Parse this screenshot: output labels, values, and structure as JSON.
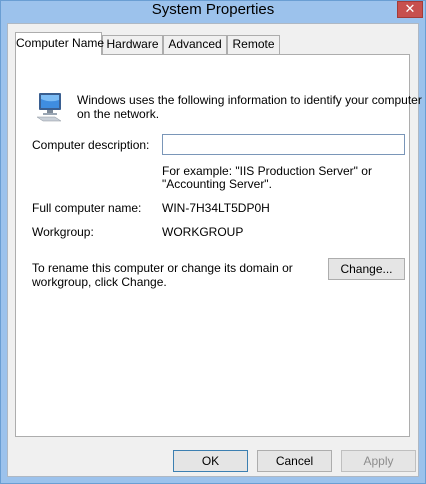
{
  "window": {
    "title": "System Properties",
    "close_glyph": "✕"
  },
  "tabs": [
    {
      "label": "Computer Name",
      "active": true
    },
    {
      "label": "Hardware",
      "active": false
    },
    {
      "label": "Advanced",
      "active": false
    },
    {
      "label": "Remote",
      "active": false
    }
  ],
  "panel": {
    "intro": "Windows uses the following information to identify your computer",
    "intro_line2": "on the network.",
    "description_label": "Computer description:",
    "description_value": "",
    "example_line1": "For example: \"IIS Production Server\" or",
    "example_line2": "\"Accounting Server\".",
    "full_name_label": "Full computer name:",
    "full_name_value": "WIN-7H34LT5DP0H",
    "workgroup_label": "Workgroup:",
    "workgroup_value": "WORKGROUP",
    "rename_line1": "To rename this computer or change its domain or",
    "rename_line2": "workgroup, click Change.",
    "change_button": "Change..."
  },
  "footer": {
    "ok": "OK",
    "cancel": "Cancel",
    "apply": "Apply"
  },
  "colors": {
    "titlebar": "#9cc2ec",
    "close": "#c7504e",
    "accent": "#3c7fb1"
  },
  "icons": {
    "computer": "computer-monitor-icon",
    "close": "close-icon"
  }
}
